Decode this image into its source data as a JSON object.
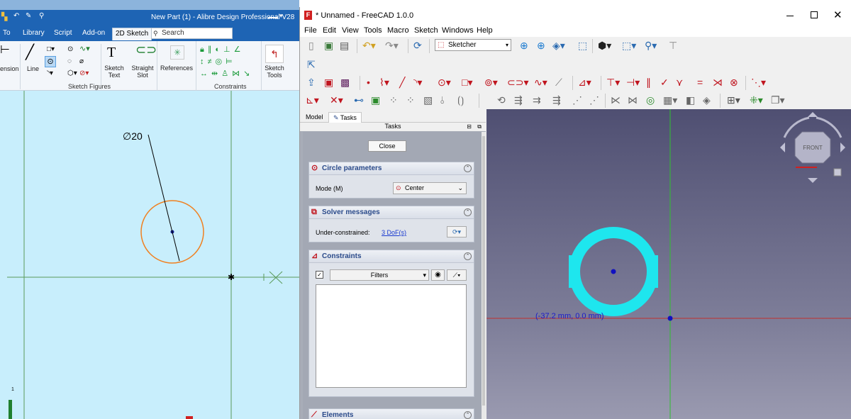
{
  "alibre": {
    "title": "New Part (1) - Alibre Design Professional V28",
    "menubar": {
      "to": "To",
      "library": "Library",
      "script": "Script",
      "addon": "Add-on",
      "sketch2d": "2D Sketch"
    },
    "search_placeholder": "Search",
    "ribbon": {
      "dimension": "ension",
      "line": "Line",
      "sketch_text_1": "Sketch",
      "sketch_text_2": "Text",
      "straight_slot_1": "Straight",
      "straight_slot_2": "Slot",
      "references": "References",
      "sketch_tools_1": "Sketch",
      "sketch_tools_2": "Tools",
      "group_figures": "Sketch Figures",
      "group_constraints": "Constraints"
    },
    "canvas": {
      "dimension_label": "∅20",
      "axis_marker": "1"
    }
  },
  "freecad": {
    "title": "* Unnamed - FreeCAD 1.0.0",
    "menus": [
      "File",
      "Edit",
      "View",
      "Tools",
      "Macro",
      "Sketch",
      "Windows",
      "Help"
    ],
    "workbench": "Sketcher",
    "panel_tabs": {
      "model": "Model",
      "tasks": "Tasks"
    },
    "tasks_header": "Tasks",
    "close_button": "Close",
    "circle_params": {
      "title": "Circle parameters",
      "mode_label": "Mode (M)",
      "mode_value": "Center"
    },
    "solver": {
      "title": "Solver messages",
      "status_label": "Under-constrained:",
      "dof_link": "3 DoF(s)"
    },
    "constraints": {
      "title": "Constraints",
      "filter": "Filters"
    },
    "elements": {
      "title": "Elements"
    },
    "viewport": {
      "coord_readout": "(-37.2 mm, 0.0 mm)",
      "navcube_face": "FRONT"
    },
    "colors": {
      "cursor_circle": "#1ee6ee",
      "axis_h": "#c03030",
      "axis_v": "#30c030"
    }
  }
}
